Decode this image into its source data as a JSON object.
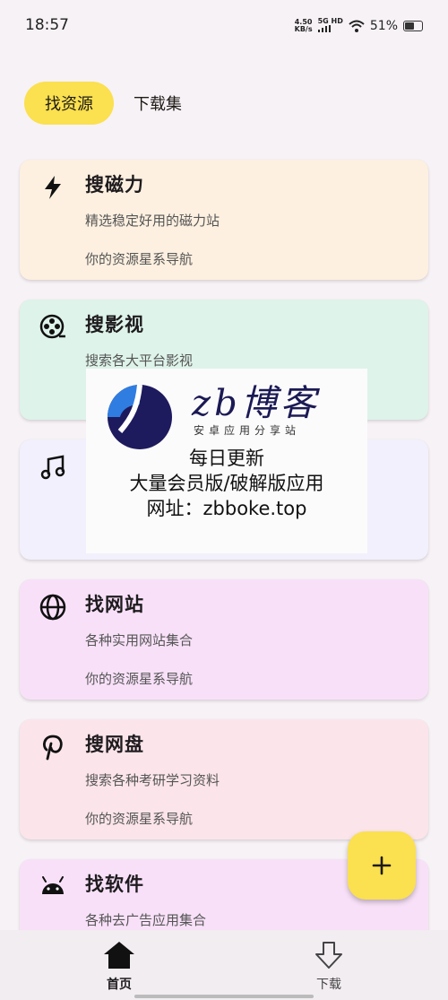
{
  "status_bar": {
    "time": "18:57",
    "net_speed_value": "4.50",
    "net_speed_unit": "KB/s",
    "network": "5G HD",
    "battery": "51%",
    "battery_level": 0.51
  },
  "tabs": [
    {
      "label": "找资源",
      "active": true
    },
    {
      "label": "下载集",
      "active": false
    }
  ],
  "cards": [
    {
      "icon": "bolt-icon",
      "title": "搜磁力",
      "desc": "精选稳定好用的磁力站",
      "sub": "你的资源星系导航",
      "bg": "#fdf0e0"
    },
    {
      "icon": "film-reel-icon",
      "title": "搜影视",
      "desc": "搜索各大平台影视",
      "sub": "",
      "bg": "#def3ea"
    },
    {
      "icon": "music-note-icon",
      "title": "",
      "desc": "",
      "sub": "",
      "bg": "#f2f0fc"
    },
    {
      "icon": "globe-icon",
      "title": "找网站",
      "desc": "各种实用网站集合",
      "sub": "你的资源星系导航",
      "bg": "#f8e1f8"
    },
    {
      "icon": "pinterest-icon",
      "title": "搜网盘",
      "desc": "搜索各种考研学习资料",
      "sub": "你的资源星系导航",
      "bg": "#fbe5ea"
    },
    {
      "icon": "android-icon",
      "title": "找软件",
      "desc": "各种去广告应用集合",
      "sub": "",
      "bg": "#f8e1f8"
    }
  ],
  "watermark": {
    "brand": "zb博客",
    "tagline": "安卓应用分享站",
    "line1": "每日更新",
    "line2": "大量会员版/破解版应用",
    "line3": "网址：zbboke.top"
  },
  "fab": {
    "label": "+",
    "icon": "plus-icon"
  },
  "bottom_nav": [
    {
      "label": "首页",
      "icon": "home-icon",
      "active": true
    },
    {
      "label": "下载",
      "icon": "download-arrow-icon",
      "active": false
    }
  ],
  "colors": {
    "accent": "#fbe04f",
    "background": "#f7f2f6"
  }
}
